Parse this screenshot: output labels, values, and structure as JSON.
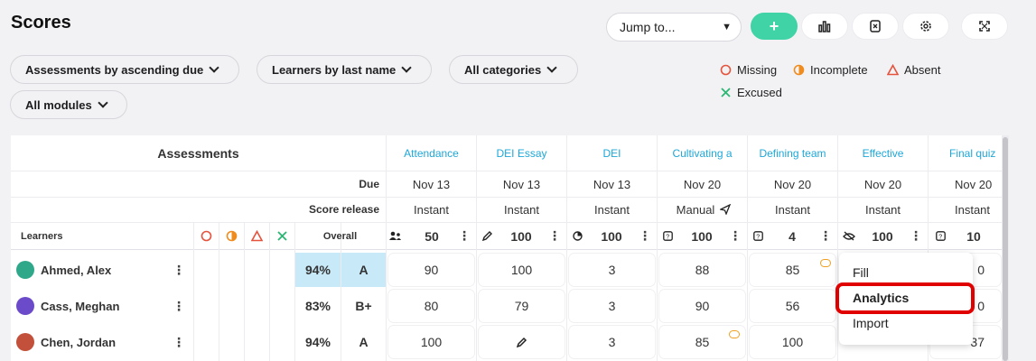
{
  "page_title": "Scores",
  "toolbar": {
    "jump_label": "Jump to...",
    "add_label": "+",
    "icons": [
      "analytics-icon",
      "export-icon",
      "settings-icon",
      "fullscreen-icon"
    ]
  },
  "filters": {
    "sort_assessments": "Assessments by ascending due",
    "sort_learners": "Learners by last name",
    "categories": "All categories",
    "modules": "All modules"
  },
  "legend": {
    "missing": "Missing",
    "incomplete": "Incomplete",
    "absent": "Absent",
    "excused": "Excused"
  },
  "colors": {
    "accent": "#3fd3a5",
    "link": "#1ea7d8",
    "missing": "#e5533d",
    "incomplete": "#f08c1e",
    "excused": "#2bb673",
    "overall_highlight": "#c8e9f8"
  },
  "table": {
    "assessments_header": "Assessments",
    "due_label": "Due",
    "release_label": "Score release",
    "learners_label": "Learners",
    "overall_label": "Overall",
    "columns": [
      {
        "title": "Attendance",
        "due": "Nov 13",
        "release": "Instant",
        "points": "50",
        "icon": "people-icon"
      },
      {
        "title": "DEI Essay",
        "due": "Nov 13",
        "release": "Instant",
        "points": "100",
        "icon": "pencil-icon"
      },
      {
        "title": "DEI",
        "due": "Nov 13",
        "release": "Instant",
        "points": "100",
        "icon": "pie-icon"
      },
      {
        "title": "Cultivating a",
        "due": "Nov 20",
        "release": "Manual",
        "points": "100",
        "icon": "quiz-icon"
      },
      {
        "title": "Defining team",
        "due": "Nov 20",
        "release": "Instant",
        "points": "4",
        "icon": "quiz-icon"
      },
      {
        "title": "Effective",
        "due": "Nov 20",
        "release": "Instant",
        "points": "100",
        "icon": "hidden-icon"
      },
      {
        "title": "Final quiz",
        "due": "Nov 20",
        "release": "Instant",
        "points": "10",
        "icon": "quiz-icon"
      }
    ],
    "rows": [
      {
        "name": "Ahmed, Alex",
        "overall": "94%",
        "grade": "A",
        "scores": [
          "90",
          "100",
          "3",
          "88",
          "85",
          "",
          "0"
        ]
      },
      {
        "name": "Cass, Meghan",
        "overall": "83%",
        "grade": "B+",
        "scores": [
          "80",
          "79",
          "3",
          "90",
          "56",
          "",
          "0"
        ]
      },
      {
        "name": "Chen, Jordan",
        "overall": "94%",
        "grade": "A",
        "scores": [
          "100",
          "",
          "3",
          "85",
          "100",
          "",
          "37"
        ]
      }
    ]
  },
  "context_menu": {
    "items": [
      "Fill",
      "Analytics",
      "Import"
    ]
  }
}
